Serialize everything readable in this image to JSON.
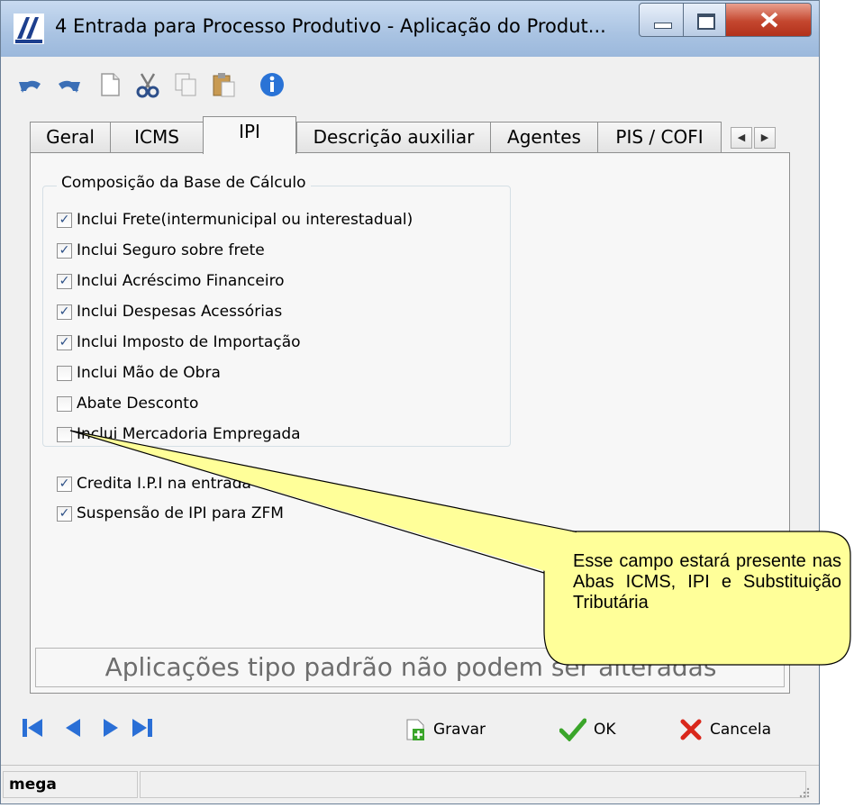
{
  "window": {
    "title": "4 Entrada para Processo Produtivo -  Aplicação do Produt..."
  },
  "toolbar": {
    "icons": [
      "undo-icon",
      "redo-icon",
      "new-document-icon",
      "cut-icon",
      "copy-icon",
      "paste-icon",
      "info-icon"
    ]
  },
  "tabs": [
    {
      "label": "Geral"
    },
    {
      "label": "ICMS"
    },
    {
      "label": "IPI",
      "active": true
    },
    {
      "label": "Descrição auxiliar"
    },
    {
      "label": "Agentes"
    },
    {
      "label": "PIS / COFI"
    }
  ],
  "group": {
    "title": "Composição da Base de Cálculo",
    "checkboxes": [
      {
        "label": "Inclui Frete(intermunicipal ou interestadual)",
        "checked": true
      },
      {
        "label": "Inclui Seguro sobre frete",
        "checked": true
      },
      {
        "label": "Inclui Acréscimo Financeiro",
        "checked": true
      },
      {
        "label": "Inclui Despesas Acessórias",
        "checked": true
      },
      {
        "label": "Inclui Imposto de Importação",
        "checked": true
      },
      {
        "label": "Inclui Mão de Obra",
        "checked": false
      },
      {
        "label": "Abate Desconto",
        "checked": false
      },
      {
        "label": "Inclui Mercadoria Empregada",
        "checked": false
      }
    ]
  },
  "extra_checkboxes": [
    {
      "label": "Credita I.P.I na entrada",
      "checked": true
    },
    {
      "label": "Suspensão de IPI para ZFM",
      "checked": true
    }
  ],
  "status_message": "Aplicações tipo padrão não podem ser alteradas",
  "callout": {
    "text": "Esse campo estará presente nas Abas ICMS, IPI e Substituição Tributária"
  },
  "buttons": {
    "save": "Gravar",
    "ok": "OK",
    "cancel": "Cancela"
  },
  "statusbar": {
    "user": "mega"
  },
  "colors": {
    "callout_fill": "#ffff99",
    "nav_arrows": "#2a6fd6",
    "ok_check": "#3aa52a",
    "cancel_x": "#d9271b"
  }
}
